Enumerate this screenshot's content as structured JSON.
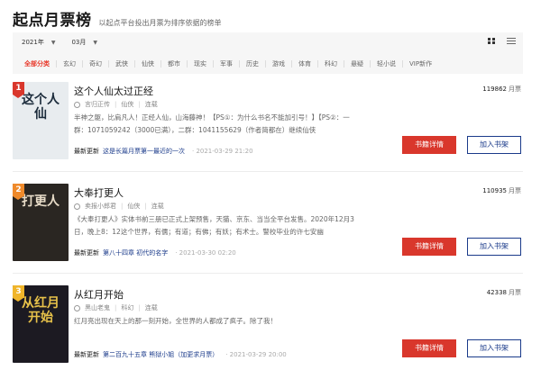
{
  "header": {
    "title": "起点月票榜",
    "subtitle": "以起点平台投出月票为排序依据的榜单"
  },
  "filters": {
    "year": "2021年",
    "month": "03月",
    "categories": [
      "全部分类",
      "玄幻",
      "奇幻",
      "武侠",
      "仙侠",
      "都市",
      "现实",
      "军事",
      "历史",
      "游戏",
      "体育",
      "科幻",
      "悬疑",
      "轻小说",
      "VIP新作"
    ],
    "active_category": "全部分类"
  },
  "books": [
    {
      "rank": "1",
      "rank_color": "#d9372c",
      "name": "这个人仙太过正经",
      "author": "言归正传",
      "genre": "仙侠",
      "status": "连载",
      "intro": "半神之躯，比肩凡人！正经人仙，山海藤神！【PS①：为什么书名不能加引号！】【PS②：一群：107105924​2（3000已满），二群：1041155629（作者简都在）继续仙侠",
      "update_label": "最新更新",
      "update_chapter": "这是长篇月票第一最近的一次",
      "update_date": "· 2021-03-29 21:20",
      "tickets": "119862",
      "ticket_unit": "月票",
      "detail_label": "书籍详情",
      "shelf_label": "加入书架",
      "cover_text": "这个人仙",
      "cover_bg": "#e8ecef",
      "cover_fg": "#1a2a3a"
    },
    {
      "rank": "2",
      "rank_color": "#ef8a2b",
      "name": "大奉打更人",
      "author": "卖报小郎君",
      "genre": "仙侠",
      "status": "连载",
      "intro": "《大奉打更人》实体书前三册已正式上架预售，天猫、京东、当当全平台发售。2020年12月3日，晚上8：12这个世界，有儒；有道；有佛；有妖；有术士。警校毕业的许七安幽",
      "update_label": "最新更新",
      "update_chapter": "第八十四章 初代的名字",
      "update_date": "· 2021-03-30 02:20",
      "tickets": "110935",
      "ticket_unit": "月票",
      "detail_label": "书籍详情",
      "shelf_label": "加入书架",
      "cover_text": "打更人",
      "cover_bg": "#2a2622",
      "cover_fg": "#e8dcc8"
    },
    {
      "rank": "3",
      "rank_color": "#f0b52a",
      "name": "从红月开始",
      "author": "黑山老鬼",
      "genre": "科幻",
      "status": "连载",
      "intro": "红月亮出现在天上的那一刻开始，全世界的人都成了疯子。除了我！",
      "update_label": "最新更新",
      "update_chapter": "第二百九十五章 熊狱小姐（加更求月票）",
      "update_date": "· 2021-03-29 20:00",
      "tickets": "42338",
      "ticket_unit": "月票",
      "detail_label": "书籍详情",
      "shelf_label": "加入书架",
      "cover_text": "从红月开始",
      "cover_bg": "#1c1a22",
      "cover_fg": "#e8c24a"
    }
  ]
}
